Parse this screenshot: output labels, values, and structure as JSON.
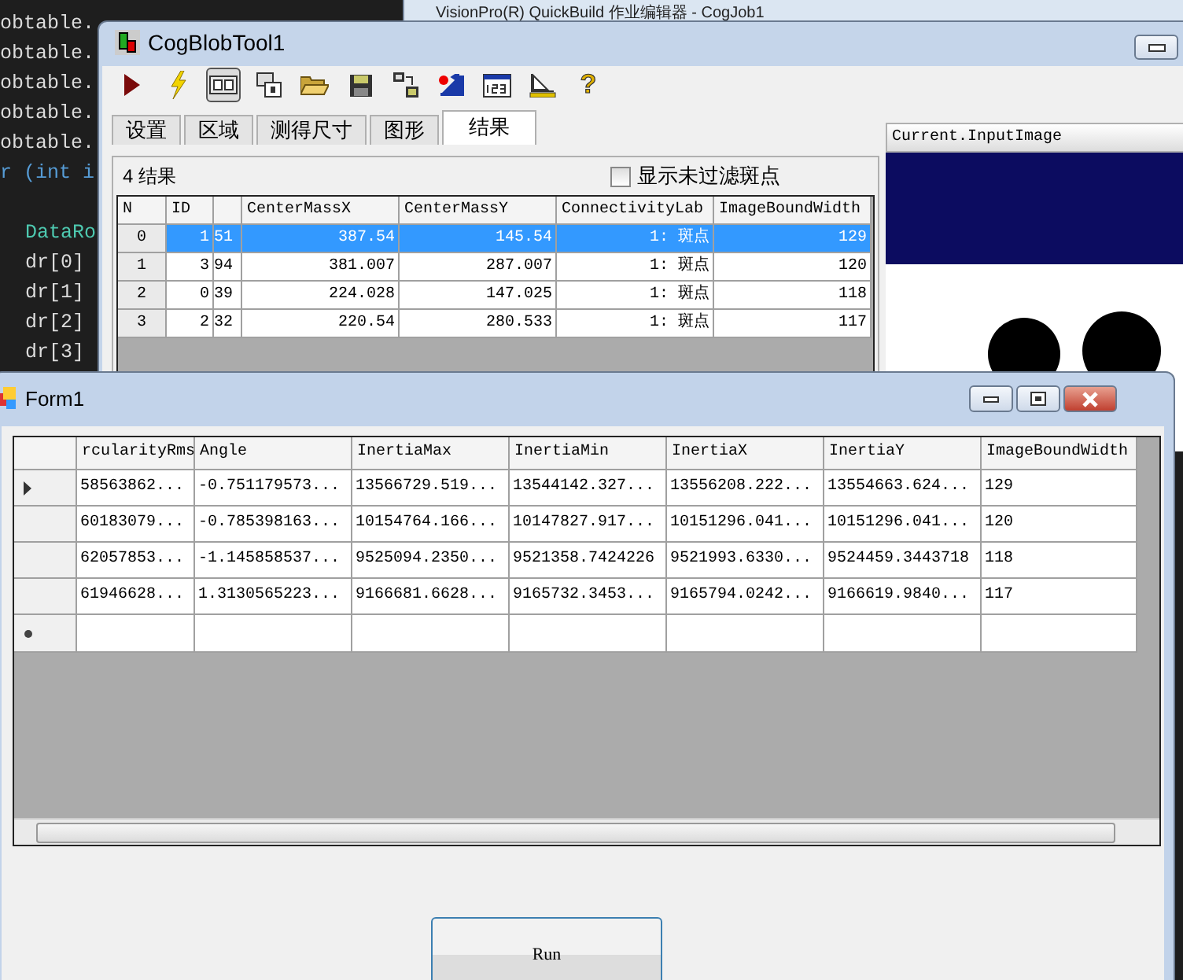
{
  "editor": {
    "lines": [
      {
        "text": "obtable.",
        "kind": "plain"
      },
      {
        "text": "obtable.",
        "kind": "plain"
      },
      {
        "text": "obtable.",
        "kind": "plain"
      },
      {
        "text": "obtable.",
        "kind": "plain"
      },
      {
        "text": "obtable.",
        "kind": "plain"
      },
      {
        "text": "r (int i",
        "kind": "keyword"
      },
      {
        "kind": "blank"
      },
      {
        "text": "DataRo",
        "kind": "type"
      },
      {
        "text": "dr[0]",
        "kind": "body"
      },
      {
        "text": "dr[1]",
        "kind": "body"
      },
      {
        "text": "dr[2]",
        "kind": "body"
      },
      {
        "text": "dr[3]",
        "kind": "body"
      }
    ]
  },
  "back_window": {
    "title": "VisionPro(R) QuickBuild 作业编辑器 - CogJob1"
  },
  "blob_window": {
    "title": "CogBlobTool1",
    "toolbar": [
      {
        "kind": "run",
        "selected": false
      },
      {
        "kind": "bolt",
        "selected": false
      },
      {
        "kind": "panel",
        "selected": true
      },
      {
        "kind": "windows",
        "selected": false
      },
      {
        "kind": "folder",
        "selected": false
      },
      {
        "kind": "save",
        "selected": false
      },
      {
        "kind": "grid",
        "selected": false
      },
      {
        "kind": "dot",
        "selected": false
      },
      {
        "kind": "field",
        "selected": false
      },
      {
        "kind": "ruler",
        "selected": false
      },
      {
        "kind": "help",
        "selected": false,
        "glyph": "?"
      }
    ],
    "tabs": [
      {
        "label": "设置",
        "selected": false
      },
      {
        "label": "区域",
        "selected": false
      },
      {
        "label": "测得尺寸",
        "selected": false
      },
      {
        "label": "图形",
        "selected": false
      },
      {
        "label": "结果",
        "selected": true
      }
    ],
    "result_count": "4 结果",
    "show_unfiltered": {
      "label": "显示未过滤斑点",
      "checked": false
    },
    "table": {
      "columns": [
        "N",
        "ID",
        "",
        "CenterMassX",
        "CenterMassY",
        "ConnectivityLab",
        "ImageBoundWidth"
      ],
      "rows": [
        {
          "selected": true,
          "cells": [
            "0",
            "1",
            "51",
            "387.54",
            "145.54",
            "1: 斑点",
            "129"
          ]
        },
        {
          "selected": false,
          "cells": [
            "1",
            "3",
            "94",
            "381.007",
            "287.007",
            "1: 斑点",
            "120"
          ]
        },
        {
          "selected": false,
          "cells": [
            "2",
            "0",
            "39",
            "224.028",
            "147.025",
            "1: 斑点",
            "118"
          ]
        },
        {
          "selected": false,
          "cells": [
            "3",
            "2",
            "32",
            "220.54",
            "280.533",
            "1: 斑点",
            "117"
          ]
        }
      ]
    },
    "image_panel": {
      "title": "Current.InputImage",
      "kind": "picture"
    }
  },
  "form1": {
    "title": "Form1",
    "table": {
      "columns": [
        "rcularityRms",
        "Angle",
        "InertiaMax",
        "InertiaMin",
        "InertiaX",
        "InertiaY",
        "ImageBoundWidth"
      ],
      "rows": [
        {
          "current": true,
          "cells": [
            "58563862...",
            "-0.751179573...",
            "13566729.519...",
            "13544142.327...",
            "13556208.222...",
            "13554663.624...",
            "129"
          ]
        },
        {
          "current": false,
          "cells": [
            "60183079...",
            "-0.785398163...",
            "10154764.166...",
            "10147827.917...",
            "10151296.041...",
            "10151296.041...",
            "120"
          ]
        },
        {
          "current": false,
          "cells": [
            "62057853...",
            "-1.145858537...",
            "9525094.2350...",
            "9521358.7424226",
            "9521993.6330...",
            "9524459.3443718",
            "118"
          ]
        },
        {
          "current": false,
          "cells": [
            "61946628...",
            "1.3130565223...",
            "9166681.6628...",
            "9165732.3453...",
            "9165794.0242...",
            "9166619.9840...",
            "117"
          ]
        }
      ]
    },
    "run_button": "Run"
  }
}
